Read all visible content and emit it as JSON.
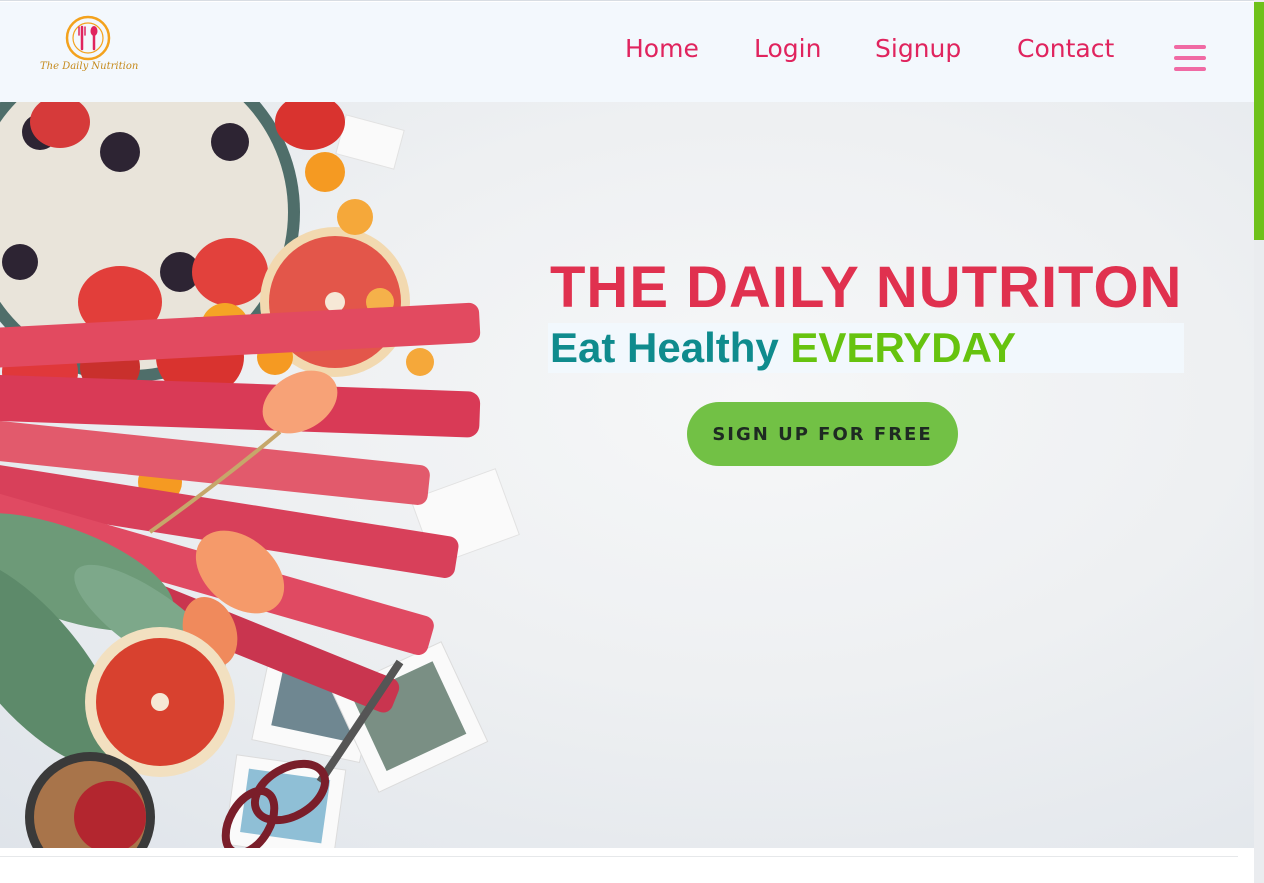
{
  "brand": {
    "logo_text": "The Daily Nutrition",
    "logo_icon": "fork-spoon-plate-icon",
    "accent": "#e0245e"
  },
  "nav": {
    "items": [
      {
        "label": "Home"
      },
      {
        "label": "Login"
      },
      {
        "label": "Signup"
      },
      {
        "label": "Contact"
      }
    ],
    "menu_icon": "hamburger-menu-icon",
    "menu_color": "#f06aa4"
  },
  "hero": {
    "headline": "THE DAILY NUTRITON",
    "tagline_part1": "Eat Healthy ",
    "tagline_part2": "EVERYDAY",
    "cta_label": "SIGN UP FOR FREE",
    "cta_color": "#72c145",
    "image_subject": "fresh-produce-flatlay"
  },
  "scrollbar": {
    "thumb_color": "#6ec11a"
  }
}
